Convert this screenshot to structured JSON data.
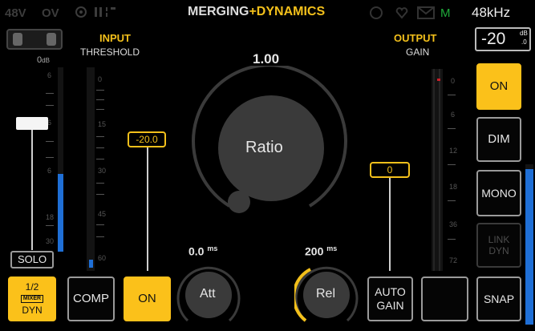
{
  "status_bar": {
    "phantom": "48V",
    "ov": "OV",
    "title_left": "MERGING",
    "title_plus": "+",
    "title_right": "DYNAMICS",
    "m_indicator": "M",
    "sample_rate": "48kHz"
  },
  "input": {
    "heading": "INPUT",
    "sub": "THRESHOLD",
    "meter_top_label": "0",
    "meter_top_unit": "dB",
    "left_scale": [
      "6",
      "",
      "",
      "6",
      "",
      "",
      "6",
      "18",
      "",
      "30"
    ],
    "threshold_scale": [
      "0",
      "",
      "",
      "15",
      "",
      "",
      "30",
      "",
      "45",
      "",
      "60"
    ],
    "threshold_value": "-20.0"
  },
  "output": {
    "heading": "OUTPUT",
    "sub": "GAIN",
    "gain_value": "0",
    "gain_scale": [
      "0",
      "",
      "6",
      "",
      "12",
      "",
      "18",
      "",
      "36",
      "",
      "72"
    ],
    "level_readout": "-20",
    "level_unit": "dB",
    "level_decimal": ".0"
  },
  "ratio": {
    "value": "1.00",
    "label": "Ratio"
  },
  "attack": {
    "value": "0.0",
    "unit": "ms",
    "label": "Att"
  },
  "release": {
    "value": "200",
    "unit": "ms",
    "label": "Rel"
  },
  "buttons": {
    "solo": "SOLO",
    "mixer_top": "1/2",
    "mixer_mid": "MIXER",
    "mixer_bottom": "DYN",
    "comp": "COMP",
    "on_center": "ON",
    "auto_gain_1": "AUTO",
    "auto_gain_2": "GAIN",
    "on_right": "ON",
    "dim": "DIM",
    "mono": "MONO",
    "link_1": "LINK",
    "link_2": "DYN",
    "snap": "SNAP"
  },
  "colors": {
    "accent": "#fbc11a",
    "meter_blue": "#1f6fd6",
    "knob": "#3a3a3a",
    "green": "#1faa3a"
  },
  "icons": [
    "gear-icon",
    "info-icon",
    "heart-icon",
    "mail-icon"
  ]
}
